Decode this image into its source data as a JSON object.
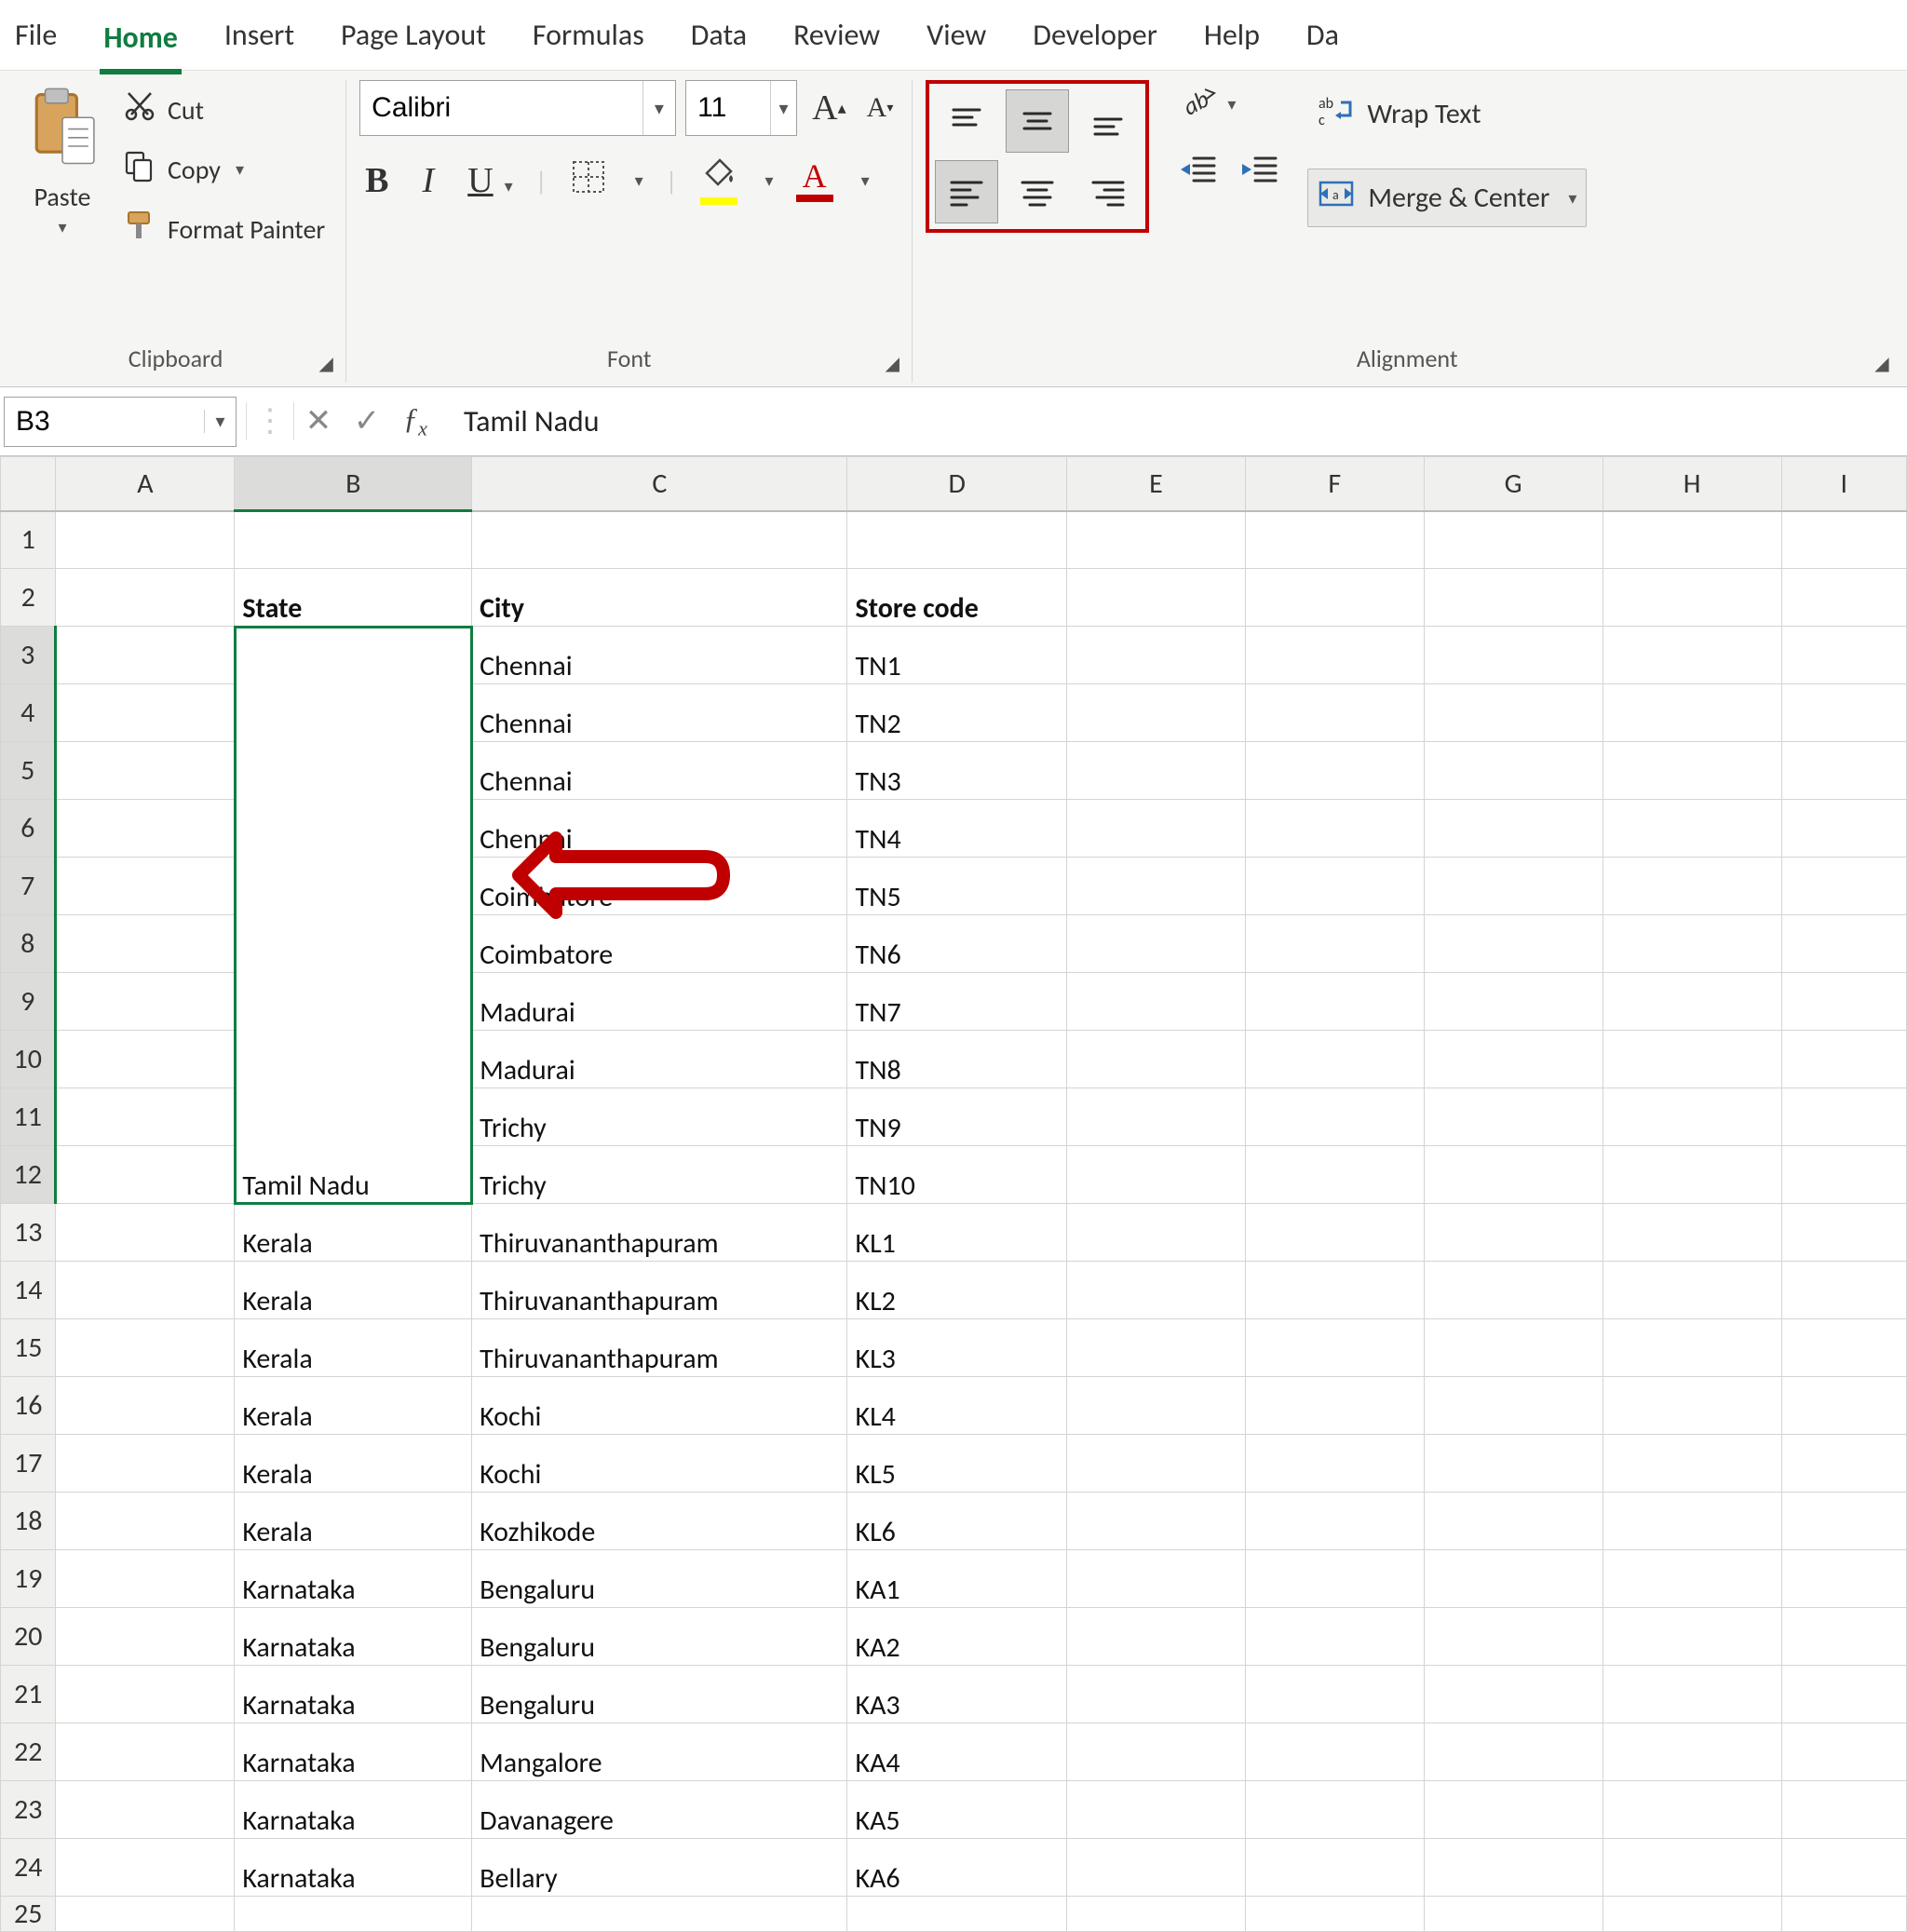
{
  "menu": {
    "items": [
      "File",
      "Home",
      "Insert",
      "Page Layout",
      "Formulas",
      "Data",
      "Review",
      "View",
      "Developer",
      "Help",
      "Da"
    ],
    "active_index": 1
  },
  "clipboard": {
    "paste_label": "Paste",
    "cut_label": "Cut",
    "copy_label": "Copy",
    "format_painter_label": "Format Painter",
    "group_label": "Clipboard"
  },
  "font": {
    "name": "Calibri",
    "size": "11",
    "increase_glyph": "A",
    "decrease_glyph": "A",
    "bold": "B",
    "italic": "I",
    "underline": "U",
    "group_label": "Font"
  },
  "alignment": {
    "wrap_label": "Wrap Text",
    "merge_label": "Merge & Center",
    "group_label": "Alignment"
  },
  "formula_bar": {
    "cell_ref": "B3",
    "cancel_glyph": "✕",
    "confirm_glyph": "✓",
    "fx": "fx",
    "formula_content": "Tamil Nadu"
  },
  "columns": [
    "A",
    "B",
    "C",
    "D",
    "E",
    "F",
    "G",
    "H",
    "I"
  ],
  "headers": {
    "state": "State",
    "city": "City",
    "store_code": "Store code"
  },
  "merged_state": "Tamil Nadu",
  "rows": [
    {
      "n": 3,
      "city": "Chennai",
      "code": "TN1"
    },
    {
      "n": 4,
      "city": "Chennai",
      "code": "TN2"
    },
    {
      "n": 5,
      "city": "Chennai",
      "code": "TN3"
    },
    {
      "n": 6,
      "city": "Chennai",
      "code": "TN4"
    },
    {
      "n": 7,
      "city": "Coimbatore",
      "code": "TN5"
    },
    {
      "n": 8,
      "city": "Coimbatore",
      "code": "TN6"
    },
    {
      "n": 9,
      "city": "Madurai",
      "code": "TN7"
    },
    {
      "n": 10,
      "city": "Madurai",
      "code": "TN8"
    },
    {
      "n": 11,
      "city": "Trichy",
      "code": "TN9"
    },
    {
      "n": 12,
      "city": "Trichy",
      "code": "TN10"
    },
    {
      "n": 13,
      "state": "Kerala",
      "city": "Thiruvananthapuram",
      "code": "KL1"
    },
    {
      "n": 14,
      "state": "Kerala",
      "city": "Thiruvananthapuram",
      "code": "KL2"
    },
    {
      "n": 15,
      "state": "Kerala",
      "city": "Thiruvananthapuram",
      "code": "KL3"
    },
    {
      "n": 16,
      "state": "Kerala",
      "city": "Kochi",
      "code": "KL4"
    },
    {
      "n": 17,
      "state": "Kerala",
      "city": "Kochi",
      "code": "KL5"
    },
    {
      "n": 18,
      "state": "Kerala",
      "city": "Kozhikode",
      "code": "KL6"
    },
    {
      "n": 19,
      "state": "Karnataka",
      "city": "Bengaluru",
      "code": "KA1"
    },
    {
      "n": 20,
      "state": "Karnataka",
      "city": "Bengaluru",
      "code": "KA2"
    },
    {
      "n": 21,
      "state": "Karnataka",
      "city": "Bengaluru",
      "code": "KA3"
    },
    {
      "n": 22,
      "state": "Karnataka",
      "city": "Mangalore",
      "code": "KA4"
    },
    {
      "n": 23,
      "state": "Karnataka",
      "city": "Davanagere",
      "code": "KA5"
    },
    {
      "n": 24,
      "state": "Karnataka",
      "city": "Bellary",
      "code": "KA6"
    }
  ],
  "last_row_label": "25",
  "annotation": {
    "color": "#c00000"
  }
}
